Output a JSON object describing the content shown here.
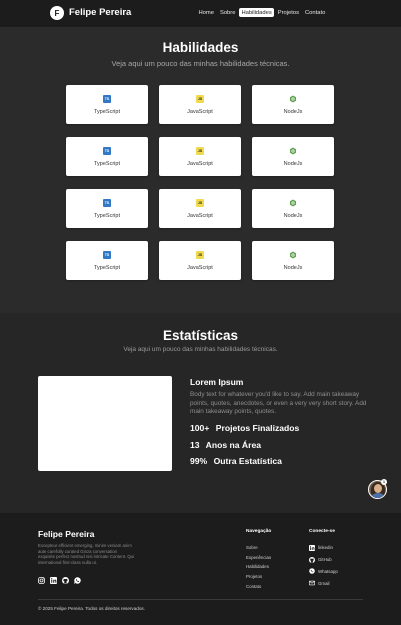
{
  "header": {
    "logo_letter": "F",
    "brand": "Felipe Pereira",
    "nav": [
      {
        "label": "Home",
        "active": false
      },
      {
        "label": "Sobre",
        "active": false
      },
      {
        "label": "Habilidades",
        "active": true
      },
      {
        "label": "Projetos",
        "active": false
      },
      {
        "label": "Contato",
        "active": false
      }
    ]
  },
  "skills": {
    "title": "Habilidades",
    "subtitle": "Veja aqui um pouco das minhas habilidades técnicas.",
    "cards": [
      {
        "label": "TypeScript",
        "icon": "typescript-icon",
        "badge": "TS"
      },
      {
        "label": "JavaScript",
        "icon": "javascript-icon",
        "badge": "JS"
      },
      {
        "label": "NodeJs",
        "icon": "nodejs-icon",
        "badge": ""
      },
      {
        "label": "TypeScript",
        "icon": "typescript-icon",
        "badge": "TS"
      },
      {
        "label": "JavaScript",
        "icon": "javascript-icon",
        "badge": "JS"
      },
      {
        "label": "NodeJs",
        "icon": "nodejs-icon",
        "badge": ""
      },
      {
        "label": "TypeScript",
        "icon": "typescript-icon",
        "badge": "TS"
      },
      {
        "label": "JavaScript",
        "icon": "javascript-icon",
        "badge": "JS"
      },
      {
        "label": "NodeJs",
        "icon": "nodejs-icon",
        "badge": ""
      },
      {
        "label": "TypeScript",
        "icon": "typescript-icon",
        "badge": "TS"
      },
      {
        "label": "JavaScript",
        "icon": "javascript-icon",
        "badge": "JS"
      },
      {
        "label": "NodeJs",
        "icon": "nodejs-icon",
        "badge": ""
      }
    ]
  },
  "stats": {
    "title": "Estatísticas",
    "subtitle": "Veja aqui um pouco das minhas habilidades técnicas.",
    "heading": "Lorem Ipsum",
    "body": "Body text for whatever you'd like to say. Add main takeaway points, quotes, anecdotes, or even a very very short story. Add main takeaway points, quotes.",
    "items": [
      {
        "number": "100+",
        "label": "Projetos Finalizados"
      },
      {
        "number": "13",
        "label": "Anos na Área"
      },
      {
        "number": "99%",
        "label": "Outra Estatística"
      }
    ],
    "avatar_badge": "1"
  },
  "footer": {
    "brand": "Felipe Pereira",
    "description": "Excepteur efficient emerging, minim veniam anim aute carefully curated Ginza conversation exquisite perfect nostrud nisi intricate Content. Qui international first-class nulla ut.",
    "socials": [
      "instagram-icon",
      "linkedin-icon",
      "github-icon",
      "whatsapp-icon"
    ],
    "nav_title": "Navegação",
    "nav_links": [
      "Sobre",
      "Experiências",
      "Habilidades",
      "Projetos",
      "Contato"
    ],
    "contact_title": "Conecte-se",
    "contacts": [
      {
        "label": "linkedin",
        "icon": "linkedin-icon"
      },
      {
        "label": "GitHub",
        "icon": "github-icon"
      },
      {
        "label": "Whatsapp",
        "icon": "whatsapp-icon"
      },
      {
        "label": "Gmail",
        "icon": "mail-icon"
      }
    ],
    "copyright": "© 2025 Felipe Pereira. Todos os direitos reservados."
  }
}
